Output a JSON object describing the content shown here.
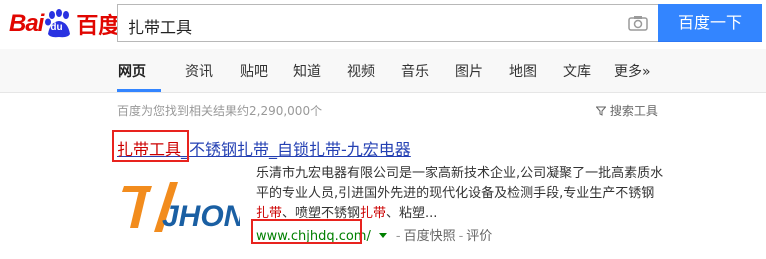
{
  "logo": {
    "bai": "Bai",
    "du": "du",
    "cn": "百度"
  },
  "search": {
    "query": "扎带工具",
    "button_label": "百度一下"
  },
  "tabs": [
    {
      "label": "网页"
    },
    {
      "label": "资讯"
    },
    {
      "label": "贴吧"
    },
    {
      "label": "知道"
    },
    {
      "label": "视频"
    },
    {
      "label": "音乐"
    },
    {
      "label": "图片"
    },
    {
      "label": "地图"
    },
    {
      "label": "文库"
    },
    {
      "label": "更多»"
    }
  ],
  "results_meta": {
    "stats": "百度为您找到相关结果约2,290,000个",
    "tools_label": "搜索工具"
  },
  "result": {
    "title_highlight": "扎带工具",
    "title_rest": "_不锈钢扎带_自锁扎带-九宏电器",
    "logo_text": "JHONG",
    "snippet_1": "乐清市九宏电器有限公司是一家高新技术企业,公司凝聚了一批高素质水平的专业人员,引进国外先进的现代化设备及检测手段,专业生产不锈钢",
    "snippet_em1": "扎带",
    "snippet_2": "、喷塑不锈钢",
    "snippet_em2": "扎带",
    "snippet_3": "、粘塑...",
    "url": "www.chjhdq.com/",
    "snapshot": "百度快照",
    "review": "评价"
  },
  "colors": {
    "brand_red": "#e10601",
    "link_blue": "#2440b3",
    "url_green": "#008000",
    "button_blue": "#3385ff",
    "annotation_red": "#e8231e"
  }
}
